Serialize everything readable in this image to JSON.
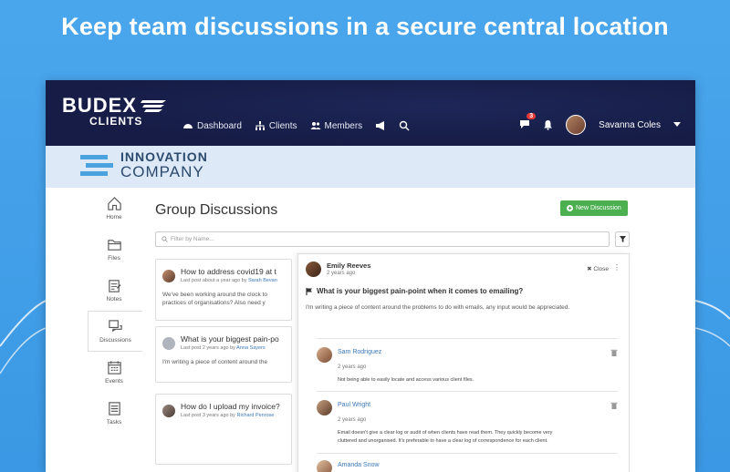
{
  "headline": "Keep team discussions in a secure central location",
  "colors": {
    "accent_green": "#4caf50",
    "topbar": "#161c45",
    "link": "#3c78b8",
    "badge": "#e53935"
  },
  "app": {
    "logo": {
      "line1": "BUDEX",
      "line2": "CLIENTS"
    },
    "nav": [
      {
        "label": "Dashboard",
        "icon": "dashboard-icon"
      },
      {
        "label": "Clients",
        "icon": "clients-icon"
      },
      {
        "label": "Members",
        "icon": "members-icon"
      }
    ],
    "notifications_count": "3",
    "user_name": "Savanna Coles",
    "company": {
      "line1": "INNOVATION",
      "line2": "COMPANY"
    }
  },
  "sidebar": {
    "items": [
      {
        "label": "Home",
        "icon": "home-icon"
      },
      {
        "label": "Files",
        "icon": "folder-icon"
      },
      {
        "label": "Notes",
        "icon": "notes-icon"
      },
      {
        "label": "Discussions",
        "icon": "discussions-icon"
      },
      {
        "label": "Events",
        "icon": "calendar-icon"
      },
      {
        "label": "Tasks",
        "icon": "tasks-icon"
      }
    ]
  },
  "main": {
    "title": "Group Discussions",
    "new_button": "New Discussion",
    "filter_placeholder": "Filter by Name...",
    "cards": [
      {
        "title": "How to address covid19 at t",
        "meta_prefix": "Last post about a year ago by",
        "author": "Sarah Bevan",
        "body": [
          "We've been working around the clock to",
          "practices of organisations? Also need y"
        ]
      },
      {
        "title": "What is your biggest pain-po",
        "meta_prefix": "Last post 2 years ago by",
        "author": "Anna Sayers",
        "body": [
          "I'm writing a piece of content around the"
        ]
      },
      {
        "title": "How do I upload my invoice?",
        "meta_prefix": "Last post 3 years ago by",
        "author": "Richard Penrose",
        "body": []
      }
    ]
  },
  "detail": {
    "author": "Emily Reeves",
    "time": "2 years ago",
    "close_label": "Close",
    "question": "What is your biggest pain-point when it comes to emailing?",
    "question_body": "I'm writing a piece of content around the problems to do with emails, any input would be appreciated.",
    "replies": [
      {
        "name": "Sam Rodriguez",
        "time": "2 years ago",
        "body": [
          "Not being able to easily locate and access various client files."
        ]
      },
      {
        "name": "Paul Wright",
        "time": "2 years ago",
        "body": [
          "Email doesn't give a clear log or audit of when clients have read them. They quickly become very",
          "cluttered and unorganised. It's preferable to have a clear log of correspondence for each client."
        ]
      },
      {
        "name": "Amanda Snow",
        "time": "",
        "body": []
      }
    ]
  }
}
